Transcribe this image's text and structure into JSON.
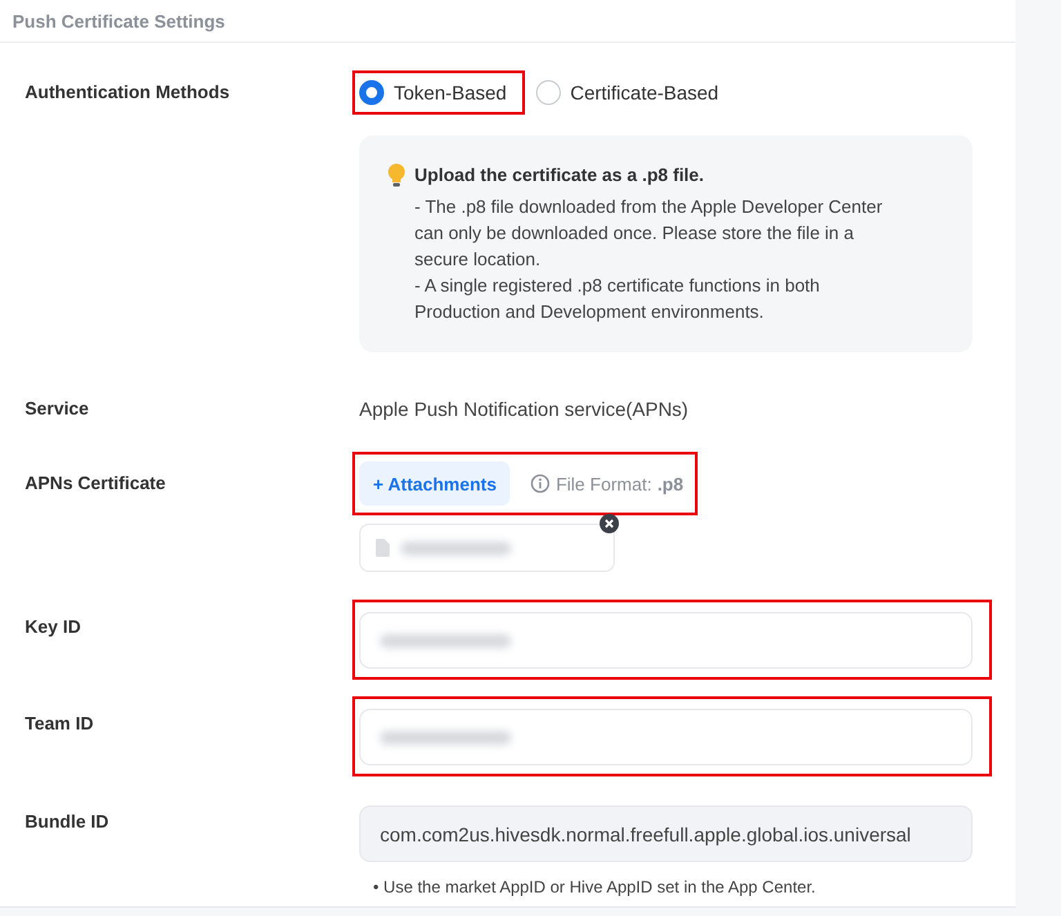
{
  "section_title": "Push Certificate Settings",
  "rows": [
    {
      "kind": "radio",
      "label": "Authentication Methods",
      "options": [
        {
          "label": "Token-Based",
          "selected": true,
          "highlighted": true
        },
        {
          "label": "Certificate-Based",
          "selected": false,
          "highlighted": false
        }
      ],
      "notice": {
        "title": "Upload the certificate as a .p8 file.",
        "lines": [
          "- The .p8 file downloaded from the Apple Developer Center can only be downloaded once. Please store the file in a secure location.",
          "- A single registered .p8 certificate functions in both Production and Development environments."
        ]
      }
    },
    {
      "kind": "text",
      "label": "Service",
      "value": "Apple Push Notification service(APNs)"
    },
    {
      "kind": "upload",
      "label": "APNs Certificate",
      "highlighted": true,
      "button": "+ Attachments",
      "format_label": "File Format:",
      "format": ".p8",
      "file": {
        "redacted": true
      }
    },
    {
      "kind": "input",
      "label": "Key ID",
      "highlighted": true,
      "redacted": true,
      "readonly": false
    },
    {
      "kind": "input",
      "label": "Team ID",
      "highlighted": true,
      "redacted": true,
      "readonly": false
    },
    {
      "kind": "input",
      "label": "Bundle ID",
      "highlighted": false,
      "readonly": true,
      "value": "com.com2us.hivesdk.normal.freefull.apple.global.ios.universal",
      "hint": "• Use the market AppID or Hive AppID set in the App Center."
    }
  ]
}
